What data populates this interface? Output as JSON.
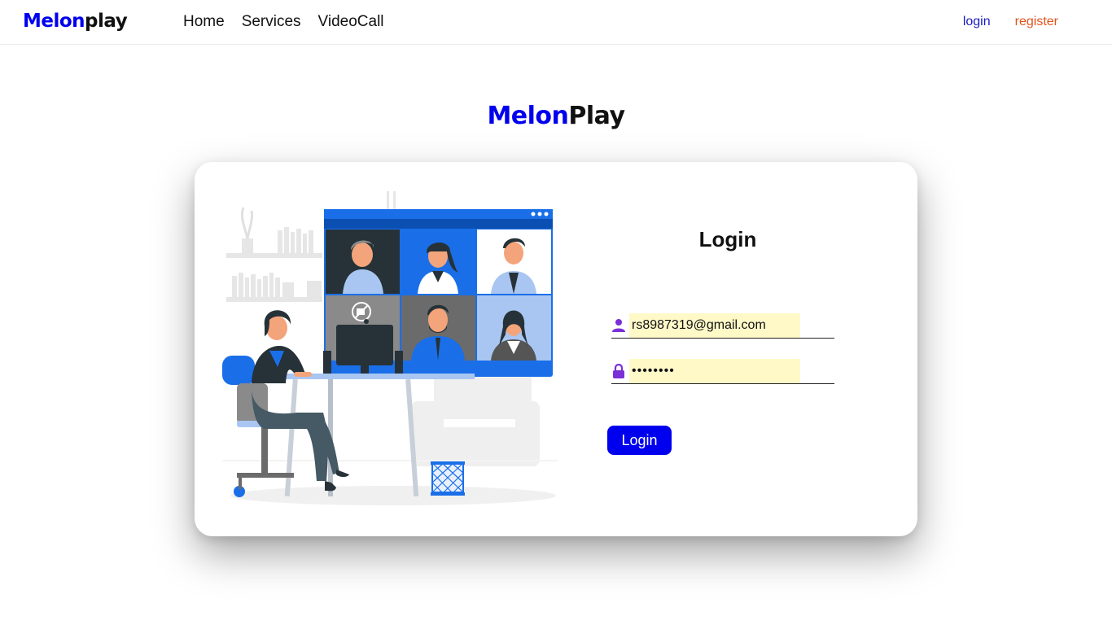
{
  "navbar": {
    "brand_part1": "Melon",
    "brand_part2": "play",
    "links": [
      "Home",
      "Services",
      "VideoCall"
    ],
    "login": "login",
    "register": "register"
  },
  "title": {
    "part1": "Melon",
    "part2": "Play"
  },
  "form": {
    "heading": "Login",
    "email_value": "rs8987319@gmail.com",
    "password_mask": "••••••••",
    "submit_label": "Login"
  },
  "colors": {
    "brand_blue": "#0000ee",
    "register_orange": "#e2531c",
    "icon_purple": "#7b2fd6",
    "autofill_yellow": "#fff9c8"
  },
  "icons": {
    "email": "user-icon",
    "password": "lock-icon"
  }
}
